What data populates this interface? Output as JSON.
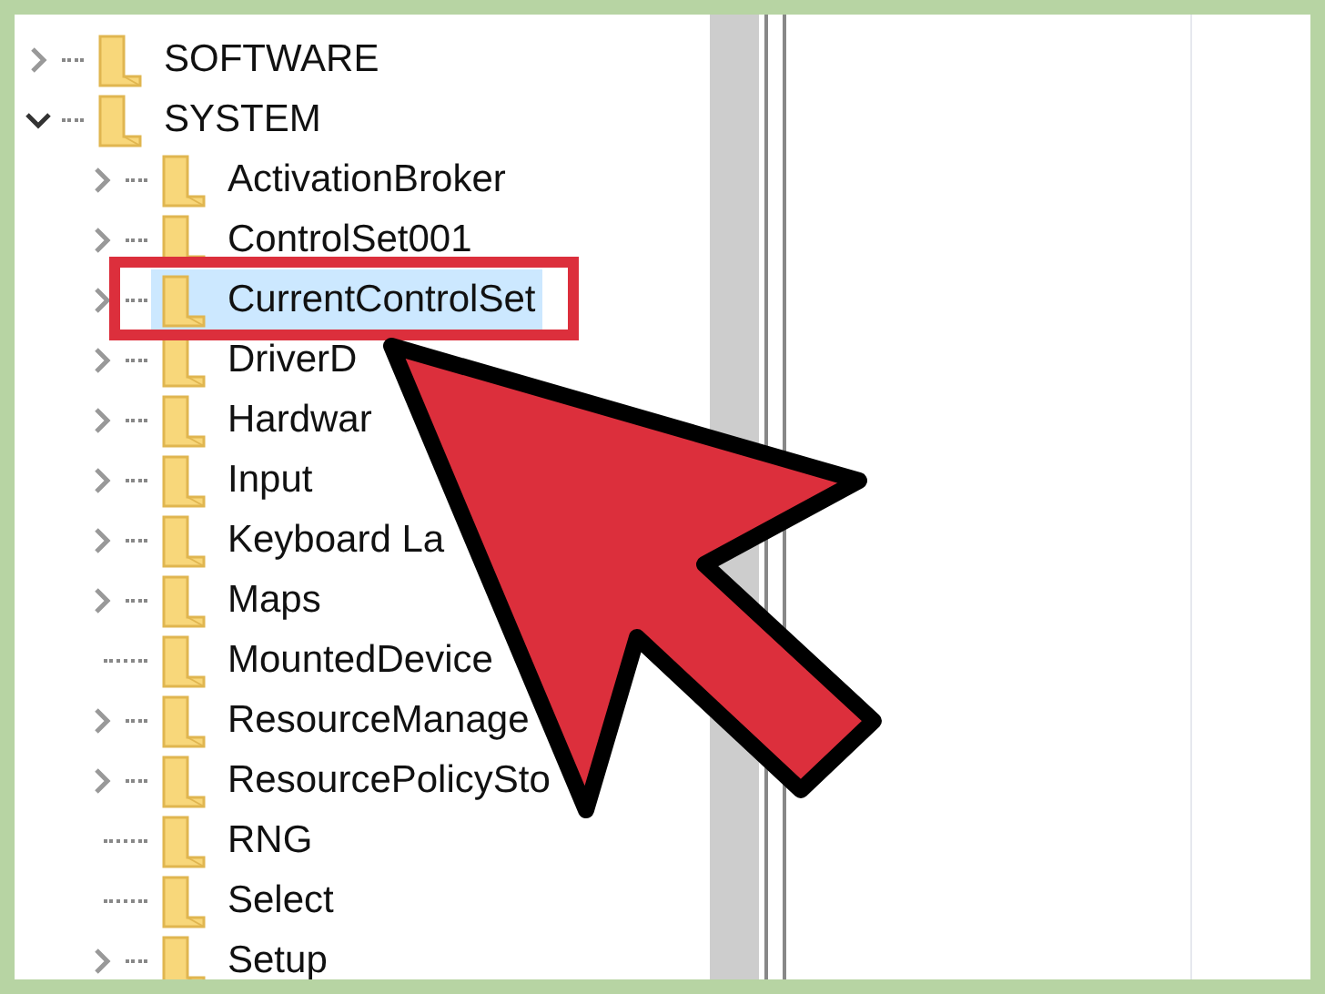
{
  "tree": [
    {
      "label": "SOFTWARE",
      "kind": "branch",
      "expanded": false,
      "selected": false
    },
    {
      "label": "SYSTEM",
      "kind": "branch",
      "expanded": true,
      "selected": false,
      "children": [
        {
          "label": "ActivationBroker",
          "kind": "branch",
          "expanded": false,
          "selected": false
        },
        {
          "label": "ControlSet001",
          "kind": "branch",
          "expanded": false,
          "selected": false
        },
        {
          "label": "CurrentControlSet",
          "kind": "branch",
          "expanded": false,
          "selected": true
        },
        {
          "label": "DriverD",
          "kind": "branch",
          "expanded": false,
          "selected": false
        },
        {
          "label": "Hardwar",
          "kind": "branch",
          "expanded": false,
          "selected": false
        },
        {
          "label": "Input",
          "kind": "branch",
          "expanded": false,
          "selected": false
        },
        {
          "label": "Keyboard La",
          "kind": "branch",
          "expanded": false,
          "selected": false
        },
        {
          "label": "Maps",
          "kind": "branch",
          "expanded": false,
          "selected": false
        },
        {
          "label": "MountedDevice",
          "kind": "leaf",
          "selected": false
        },
        {
          "label": "ResourceManage",
          "kind": "branch",
          "expanded": false,
          "selected": false
        },
        {
          "label": "ResourcePolicySto",
          "kind": "branch",
          "expanded": false,
          "selected": false
        },
        {
          "label": "RNG",
          "kind": "leaf",
          "selected": false
        },
        {
          "label": "Select",
          "kind": "leaf",
          "selected": false
        },
        {
          "label": "Setup",
          "kind": "branch",
          "expanded": false,
          "selected": false
        }
      ]
    }
  ]
}
